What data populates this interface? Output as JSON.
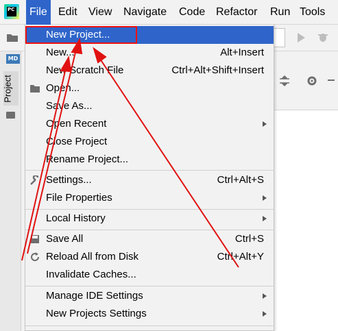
{
  "menubar": {
    "logo_text": "PC",
    "items": [
      "File",
      "Edit",
      "View",
      "Navigate",
      "Code",
      "Refactor",
      "Run",
      "Tools"
    ]
  },
  "side": {
    "md_badge": "MD",
    "project_tab": "Project"
  },
  "file_menu": {
    "items": [
      {
        "label": "New Project...",
        "shortcut": ""
      },
      {
        "label": "New...",
        "shortcut": "Alt+Insert"
      },
      {
        "label": "New Scratch File",
        "shortcut": "Ctrl+Alt+Shift+Insert"
      },
      {
        "label": "Open...",
        "shortcut": ""
      },
      {
        "label": "Save As...",
        "shortcut": ""
      },
      {
        "label": "Open Recent",
        "shortcut": ""
      },
      {
        "label": "Close Project",
        "shortcut": ""
      },
      {
        "label": "Rename Project...",
        "shortcut": ""
      },
      {
        "label": "Settings...",
        "shortcut": "Ctrl+Alt+S"
      },
      {
        "label": "File Properties",
        "shortcut": ""
      },
      {
        "label": "Local History",
        "shortcut": ""
      },
      {
        "label": "Save All",
        "shortcut": "Ctrl+S"
      },
      {
        "label": "Reload All from Disk",
        "shortcut": "Ctrl+Alt+Y"
      },
      {
        "label": "Invalidate Caches...",
        "shortcut": ""
      },
      {
        "label": "Manage IDE Settings",
        "shortcut": ""
      },
      {
        "label": "New Projects Settings",
        "shortcut": ""
      }
    ]
  },
  "colors": {
    "highlight": "#2f65ca",
    "annotation": "#e11111"
  },
  "icons": [
    "folder-icon",
    "wrench-icon",
    "save-icon",
    "reload-icon",
    "gear-icon",
    "run-icon",
    "bug-icon"
  ]
}
